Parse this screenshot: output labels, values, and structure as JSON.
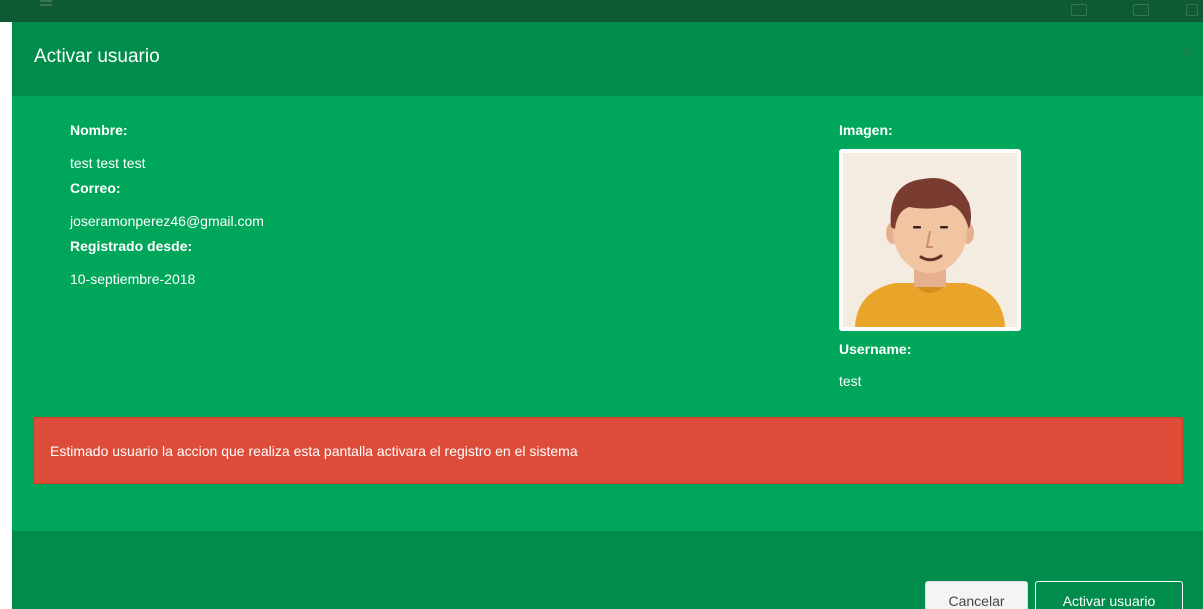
{
  "modal": {
    "title": "Activar usuario",
    "close_label": "×"
  },
  "user": {
    "nombre_label": "Nombre:",
    "nombre": "test test test",
    "correo_label": "Correo:",
    "correo": "joseramonperez46@gmail.com",
    "registrado_label": "Registrado desde:",
    "registrado": "10-septiembre-2018",
    "imagen_label": "Imagen:",
    "username_label": "Username:",
    "username": "test"
  },
  "alert": {
    "message": "Estimado usuario la accion que realiza esta pantalla activara el registro en el sistema"
  },
  "footer": {
    "cancel_label": "Cancelar",
    "activate_label": "Activar usuario"
  },
  "colors": {
    "modal_body": "#00a65a",
    "modal_header": "#008d4c",
    "alert_danger": "#dd4b39",
    "backdrop": "#0d5a34"
  },
  "icons": {
    "close": "close-icon",
    "avatar": "user-avatar-image"
  }
}
